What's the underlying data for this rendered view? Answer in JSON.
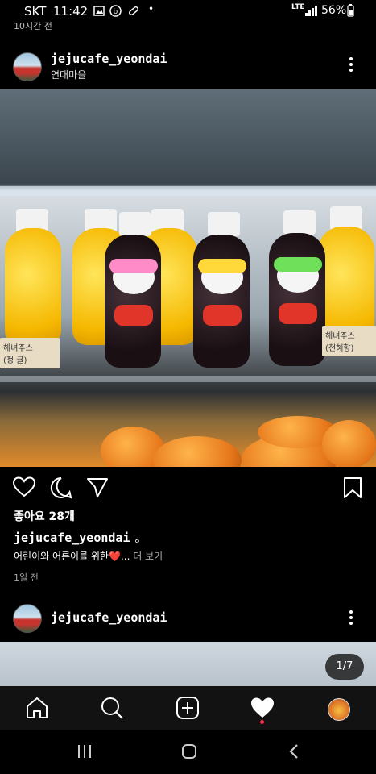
{
  "status_bar": {
    "carrier": "SKT",
    "time": "11:42",
    "network": "LTE",
    "battery": "56%",
    "icons": [
      "gallery-icon",
      "b-icon",
      "pill-icon",
      "dot-icon"
    ]
  },
  "top_post": {
    "time_ago": "10시간 전"
  },
  "post": {
    "username": "jejucafe_yeondai",
    "location": "연대마을",
    "tags": [
      "해녀주스\n(청 귤)",
      "해녀주스\n(천혜향)"
    ],
    "likes": "좋아요 28개",
    "caption_user": "jejucafe_yeondai",
    "caption_mark": "。",
    "caption_text": "어린이와 어른이를 위한",
    "caption_emoji": "❤️",
    "caption_ellipsis": "...",
    "caption_more": "더 보기",
    "time_ago": "1일 전"
  },
  "next_post": {
    "username": "jejucafe_yeondai",
    "pager": "1/7"
  },
  "tabbar": {
    "items": [
      "home-icon",
      "search-icon",
      "add-icon",
      "heart-icon",
      "profile-icon"
    ],
    "active": "heart-icon"
  },
  "navbar": {
    "items": [
      "recents-icon",
      "home-button-icon",
      "back-icon"
    ]
  },
  "colors": {
    "background": "#000000",
    "notification_dot": "#ff2e4e"
  }
}
